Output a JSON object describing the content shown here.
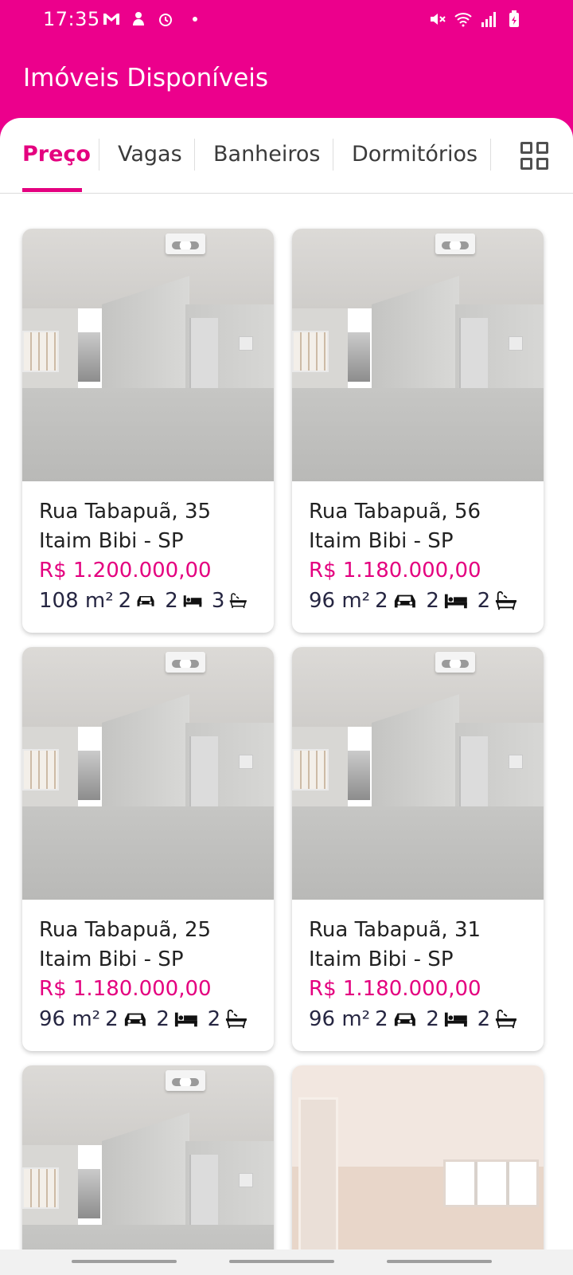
{
  "status_bar": {
    "time": "17:35",
    "left_icons": [
      "gmail-icon",
      "notification-icon",
      "alarm-icon"
    ],
    "right_icons": [
      "mute-icon",
      "wifi-icon",
      "signal-icon",
      "battery-icon"
    ]
  },
  "app_bar": {
    "title": "Imóveis Disponíveis"
  },
  "tabs": [
    {
      "label": "Preço",
      "active": true
    },
    {
      "label": "Vagas",
      "active": false
    },
    {
      "label": "Banheiros",
      "active": false
    },
    {
      "label": "Dormitórios",
      "active": false
    }
  ],
  "grid_toggle_icon": "grid-view-icon",
  "colors": {
    "brand": "#EC008C",
    "accent": "#E4007F",
    "text": "#262642"
  },
  "listings": [
    {
      "street": "Rua Tabapuã, 35",
      "district": "Itaim Bibi - SP",
      "price": "R$ 1.200.000,00",
      "area": "108 m²",
      "parking": "2",
      "bedrooms": "2",
      "bathrooms": "3"
    },
    {
      "street": "Rua Tabapuã, 56",
      "district": "Itaim Bibi - SP",
      "price": "R$ 1.180.000,00",
      "area": "96 m²",
      "parking": "2",
      "bedrooms": "2",
      "bathrooms": "2"
    },
    {
      "street": "Rua Tabapuã, 25",
      "district": "Itaim Bibi - SP",
      "price": "R$ 1.180.000,00",
      "area": "96 m²",
      "parking": "2",
      "bedrooms": "2",
      "bathrooms": "2"
    },
    {
      "street": "Rua Tabapuã, 31",
      "district": "Itaim Bibi - SP",
      "price": "R$ 1.180.000,00",
      "area": "96 m²",
      "parking": "2",
      "bedrooms": "2",
      "bathrooms": "2"
    }
  ]
}
